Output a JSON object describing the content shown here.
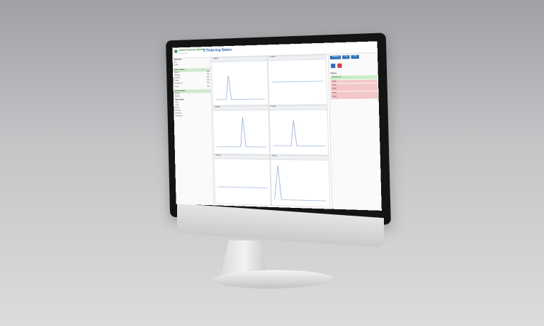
{
  "app": {
    "brand": "Vision Premium Monitor",
    "brand_sub": "Control system",
    "page_title": "1 Tinkering Status"
  },
  "left_panel": {
    "title": "Operation",
    "rows_top": [
      {
        "k": "Run",
        "v": ""
      },
      {
        "k": "Cycle",
        "v": ""
      }
    ],
    "section1": "Status values",
    "rows1": [
      {
        "k": "Speed",
        "v": "Ok"
      },
      {
        "k": "Voltage",
        "v": "Ok"
      },
      {
        "k": "Current",
        "v": "Ok"
      },
      {
        "k": "Power",
        "v": "Ok"
      },
      {
        "k": "Frequency",
        "v": "Ok"
      },
      {
        "k": "Temp",
        "v": "Ok"
      }
    ],
    "section2": "Actual values",
    "rows2": [
      {
        "k": "Torque",
        "v": ""
      },
      {
        "k": "Speed",
        "v": ""
      }
    ],
    "section3": "Fault status",
    "rows3": [
      {
        "k": "U ph",
        "v": ""
      },
      {
        "k": "V ph",
        "v": ""
      },
      {
        "k": "W ph",
        "v": ""
      },
      {
        "k": "DC link",
        "v": ""
      },
      {
        "k": "Overvolt",
        "v": ""
      },
      {
        "k": "Undervolt",
        "v": ""
      }
    ]
  },
  "charts": {
    "c1": "Speed",
    "c2": "Current",
    "c3": "Voltage",
    "c4": "Power",
    "c5": "Torque",
    "c6": "Temp"
  },
  "right_panel": {
    "tabs": [
      "Settings",
      "Log",
      "Info"
    ],
    "label": "Alarms",
    "alarms": [
      {
        "text": "Network ok",
        "level": "green"
      },
      {
        "text": "Fault",
        "level": "red"
      },
      {
        "text": "Fault",
        "level": "red"
      },
      {
        "text": "Fault",
        "level": "red"
      },
      {
        "text": "Fault",
        "level": "red"
      },
      {
        "text": "Fault",
        "level": "red"
      }
    ]
  },
  "colors": {
    "accent": "#2f6db5",
    "ok_green": "#cfe8cf",
    "alarm_red": "#f4c7c7",
    "brand_green": "#3c9a4c"
  }
}
